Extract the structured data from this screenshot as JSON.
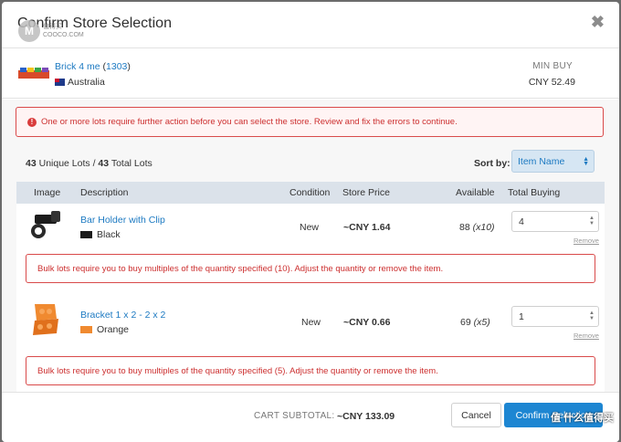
{
  "modal": {
    "title": "Confirm Store Selection",
    "close_glyph": "✖"
  },
  "watermark": {
    "badge": "M",
    "top_text": "值得买",
    "sub_text": "COOCO.COM",
    "bottom_text": "值 什么值得买"
  },
  "store": {
    "name": "Brick 4 me",
    "feedback": "1303",
    "country": "Australia",
    "min_buy_label": "MIN BUY",
    "min_buy_value": "CNY 52.49"
  },
  "alerts": {
    "top": "One or more lots require further action before you can select the store. Review and fix the errors to continue."
  },
  "lots_summary": {
    "unique": "43",
    "unique_label": "Unique Lots /",
    "total": "43",
    "total_label": "Total Lots"
  },
  "sort": {
    "label": "Sort by:",
    "selected": "Item Name"
  },
  "table": {
    "headers": {
      "image": "Image",
      "description": "Description",
      "condition": "Condition",
      "price": "Store Price",
      "available": "Available",
      "buying": "Total Buying"
    },
    "rows": [
      {
        "name": "Bar Holder with Clip",
        "color": "Black",
        "color_hex": "#1c1c1c",
        "condition": "New",
        "price": "~CNY 1.64",
        "available": "88",
        "multiple": "(x10)",
        "qty": "4",
        "remove": "Remove",
        "error": "Bulk lots require you to buy multiples of the quantity specified (10). Adjust the quantity or remove the item."
      },
      {
        "name": "Bracket 1 x 2 - 2 x 2",
        "color": "Orange",
        "color_hex": "#f08a30",
        "condition": "New",
        "price": "~CNY 0.66",
        "available": "69",
        "multiple": "(x5)",
        "qty": "1",
        "remove": "Remove",
        "error": "Bulk lots require you to buy multiples of the quantity specified (5). Adjust the quantity or remove the item."
      }
    ]
  },
  "footer": {
    "subtotal_label": "CART SUBTOTAL:",
    "subtotal_value": "~CNY 133.09",
    "cancel": "Cancel",
    "confirm": "Confirm Selection"
  }
}
